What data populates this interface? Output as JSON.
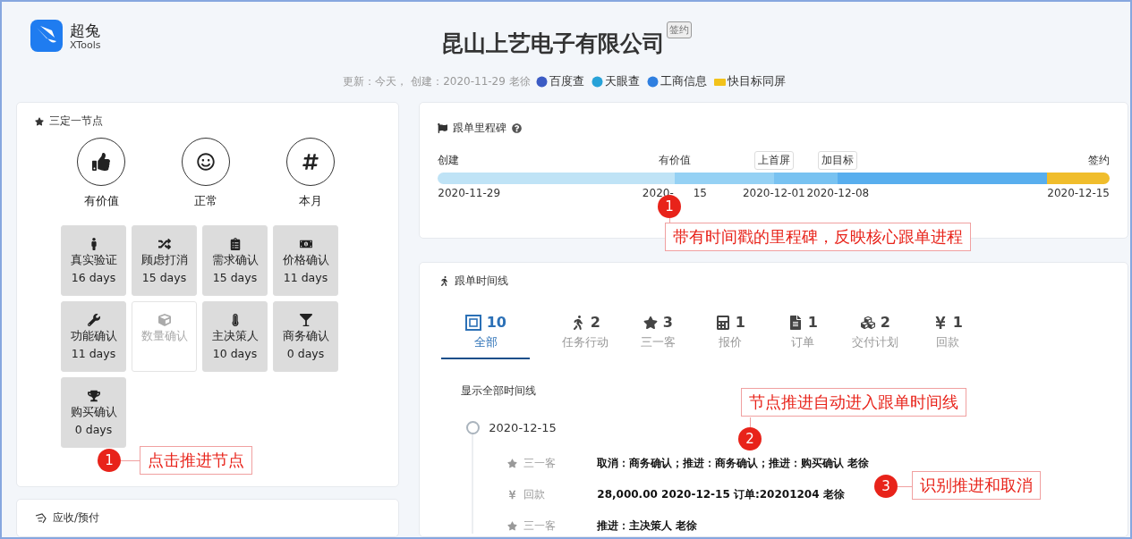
{
  "brand": {
    "name": "超兔",
    "sub": "XTools"
  },
  "header": {
    "title": "昆山上艺电子有限公司",
    "badge": "签约",
    "meta": "更新：今天， 创建：2020-11-29 老徐",
    "links": [
      "百度查",
      "天眼查",
      "工商信息",
      "快目标同屏"
    ]
  },
  "nodes_card": {
    "title": "三定一节点",
    "summary": [
      {
        "label": "有价值"
      },
      {
        "label": "正常"
      },
      {
        "label": "本月"
      }
    ],
    "nodes": [
      {
        "label": "真实验证",
        "days": "16 days",
        "done": true
      },
      {
        "label": "顾虑打消",
        "days": "15 days",
        "done": true
      },
      {
        "label": "需求确认",
        "days": "15 days",
        "done": true
      },
      {
        "label": "价格确认",
        "days": "11 days",
        "done": true
      },
      {
        "label": "功能确认",
        "days": "11 days",
        "done": true
      },
      {
        "label": "数量确认",
        "done": false
      },
      {
        "label": "主决策人",
        "days": "10 days",
        "done": true
      },
      {
        "label": "商务确认",
        "days": "0 days",
        "done": true
      },
      {
        "label": "购买确认",
        "days": "0 days",
        "done": true
      }
    ]
  },
  "receivable_card": {
    "title": "应收/预付"
  },
  "milestones_card": {
    "title": "跟单里程碑",
    "milestones": [
      {
        "label": "创建",
        "boxed": false,
        "date": "2020-11-29",
        "color": "#bfe3f6"
      },
      {
        "label": "有价值",
        "boxed": false,
        "date": "2020-",
        "date_tail": "15",
        "color": "#95d1f4"
      },
      {
        "label": "上首屏",
        "boxed": true,
        "date": "2020-12-01",
        "color": "#78c2f1"
      },
      {
        "label": "加目标",
        "boxed": true,
        "date": "2020-12-08",
        "color": "#58aeee"
      },
      {
        "label": "签约",
        "boxed": false,
        "date": "2020-12-15",
        "color": "#f0bd2c"
      }
    ]
  },
  "timeline_card": {
    "title": "跟单时间线",
    "tabs": [
      {
        "count": "10",
        "label": "全部",
        "selected": true
      },
      {
        "count": "2",
        "label": "任务行动",
        "selected": false
      },
      {
        "count": "3",
        "label": "三一客",
        "selected": false
      },
      {
        "count": "1",
        "label": "报价",
        "selected": false
      },
      {
        "count": "1",
        "label": "订单",
        "selected": false
      },
      {
        "count": "2",
        "label": "交付计划",
        "selected": false
      },
      {
        "count": "1",
        "label": "回款",
        "selected": false
      }
    ],
    "show_all": "显示全部时间线",
    "date": "2020-12-15",
    "entries": [
      {
        "kind": "star",
        "type": "三一客",
        "text": "取消：商务确认；推进：商务确认；推进：购买确认 老徐"
      },
      {
        "kind": "yen",
        "type": "回款",
        "text": "28,000.00 2020-12-15 订单:20201204 老徐"
      },
      {
        "kind": "star",
        "type": "三一客",
        "text": "推进：主决策人 老徐"
      }
    ]
  },
  "annotations": [
    {
      "number": "1",
      "text": "点击推进节点"
    },
    {
      "number": "1",
      "text": "带有时间戳的里程碑，反映核心跟单进程"
    },
    {
      "number": "2",
      "text": "节点推进自动进入跟单时间线"
    },
    {
      "number": "3",
      "text": "识别推进和取消"
    }
  ]
}
